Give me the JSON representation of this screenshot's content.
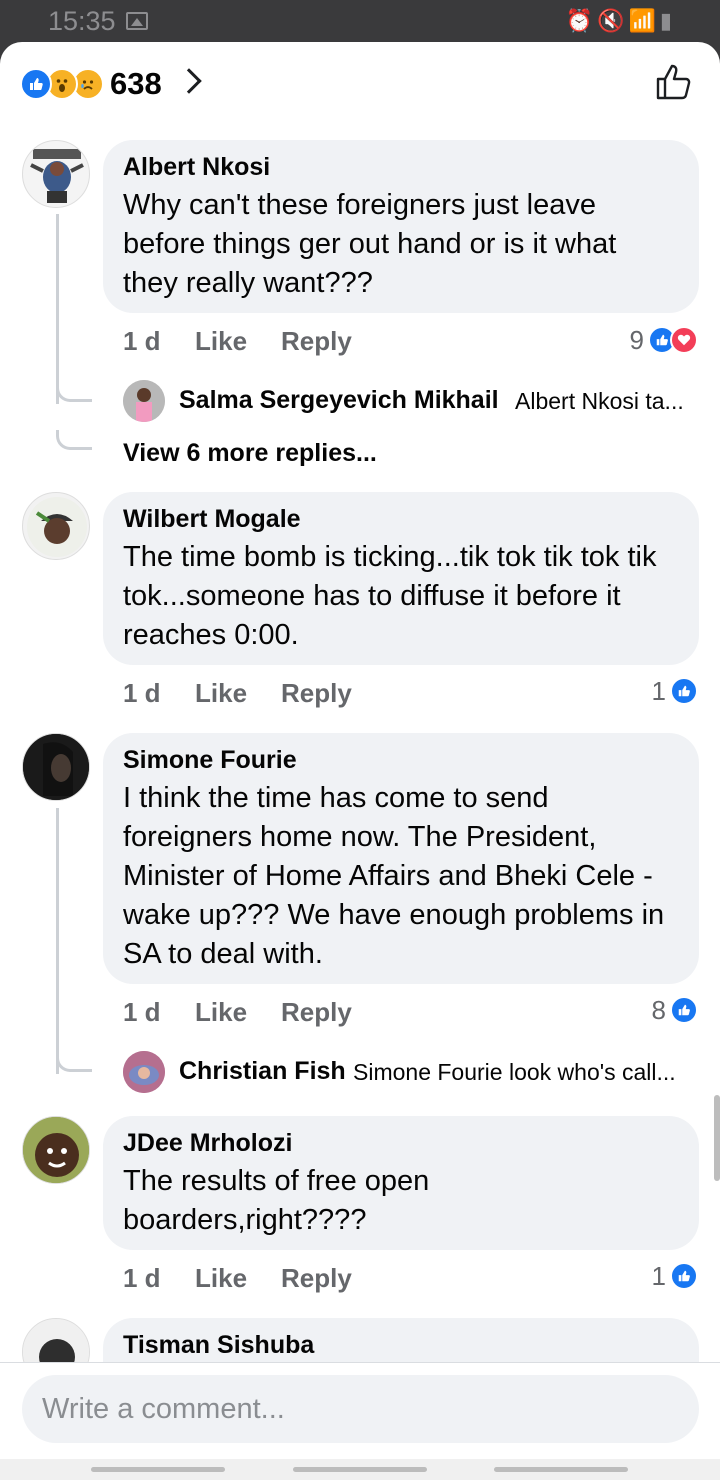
{
  "status_bar": {
    "time": "15:35",
    "icons": [
      "gallery-icon",
      "alarm-icon",
      "mute-icon",
      "wifi-icon",
      "signal-icon",
      "battery-icon"
    ]
  },
  "reactions_header": {
    "count": "638",
    "emoji_types": [
      "like",
      "wow",
      "sad"
    ]
  },
  "comments": [
    {
      "name": "Albert Nkosi",
      "text": "Why can't these foreigners  just leave before things ger out hand or is it what they really want???",
      "time": "1 d",
      "like_label": "Like",
      "reply_label": "Reply",
      "reaction_count": "9",
      "reactions": [
        "like",
        "love"
      ]
    },
    {
      "name": "Wilbert Mogale",
      "text": "The time bomb is ticking...tik tok tik tok tik tok...someone has to diffuse it before it reaches 0:00.",
      "time": "1 d",
      "like_label": "Like",
      "reply_label": "Reply",
      "reaction_count": "1",
      "reactions": [
        "like"
      ]
    },
    {
      "name": "Simone Fourie",
      "text": "I think the time has come to send foreigners home now.  The President, Minister of Home Affairs and Bheki Cele - wake up??? We have enough problems in SA to deal with.",
      "time": "1 d",
      "like_label": "Like",
      "reply_label": "Reply",
      "reaction_count": "8",
      "reactions": [
        "like"
      ]
    },
    {
      "name": "JDee Mrholozi",
      "text": "The results of free open boarders,right????",
      "time": "1 d",
      "like_label": "Like",
      "reply_label": "Reply",
      "reaction_count": "1",
      "reactions": [
        "like"
      ]
    },
    {
      "name": "Tisman Sishuba"
    }
  ],
  "replies": [
    {
      "name": "Salma Sergeyevich Mikhail",
      "text": "Albert Nkosi ta..."
    },
    {
      "name": "Christian Fish",
      "text": "Simone Fourie look who's call..."
    }
  ],
  "view_more_replies": "View 6 more replies...",
  "composer": {
    "placeholder": "Write a comment..."
  }
}
